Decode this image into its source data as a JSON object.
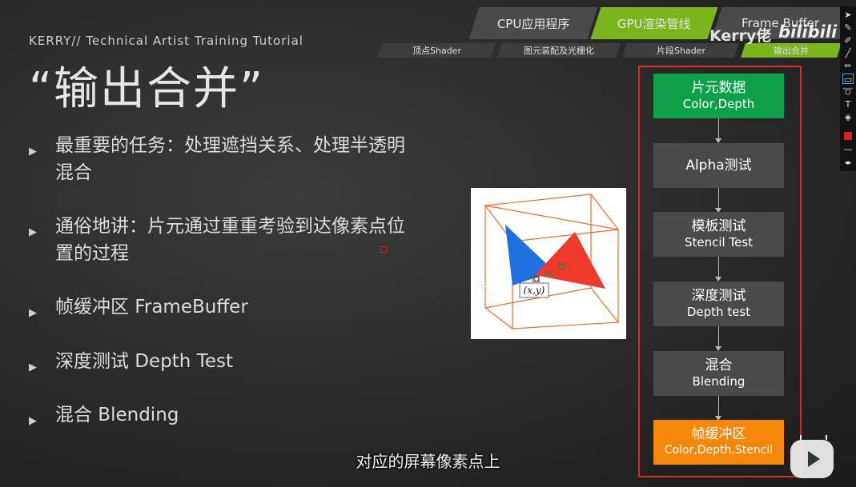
{
  "header": {
    "tabs": [
      "CPU应用程序",
      "GPU渲染管线",
      "Frame Buffer"
    ],
    "subtabs": [
      "顶点Shader",
      "图元装配及光栅化",
      "片段Shader",
      "输出合并"
    ],
    "watermark": "Kerry佬",
    "logo_text": "bilibili"
  },
  "slide": {
    "brand": "KERRY// Technical Artist Training Tutorial",
    "title": "“输出合并”",
    "bullets": [
      {
        "line1": "最重要的任务：处理遮挡关系、处理半透明",
        "line2": "混合"
      },
      {
        "line1": "通俗地讲：片元通过重重考验到达像素点位",
        "line2": "置的过程"
      },
      {
        "line1": "帧缓冲区 FrameBuffer",
        "line2": ""
      },
      {
        "line1": "深度测试 Depth Test",
        "line2": ""
      },
      {
        "line1": "混合 Blending",
        "line2": ""
      }
    ],
    "diagram_label": "(x,y)"
  },
  "pipeline": {
    "stages": [
      {
        "title": "片元数据",
        "sub": "Color,Depth",
        "color": "#0fa04a"
      },
      {
        "title": "Alpha测试",
        "sub": "",
        "color": "#4a4a4a"
      },
      {
        "title": "模板测试",
        "sub": "Stencil Test",
        "color": "#4a4a4a"
      },
      {
        "title": "深度测试",
        "sub": "Depth test",
        "color": "#4a4a4a"
      },
      {
        "title": "混合",
        "sub": "Blending",
        "color": "#4a4a4a"
      },
      {
        "title": "帧缓冲区",
        "sub": "Color,Depth,Stencil",
        "color": "#f5870a"
      }
    ]
  },
  "colors": {
    "accent_green": "#7ab51d",
    "highlight_red": "#d82a2a"
  },
  "toolbar": {
    "icons": [
      "pointer-icon",
      "pen-icon",
      "marker-icon",
      "line-icon",
      "brush-icon",
      "rectangle-icon",
      "lasso-icon",
      "text-icon",
      "eraser-icon",
      "color-swatch-icon",
      "stroke-width-icon",
      "expand-icon"
    ]
  },
  "subtitle": "对应的屏幕像素点上"
}
